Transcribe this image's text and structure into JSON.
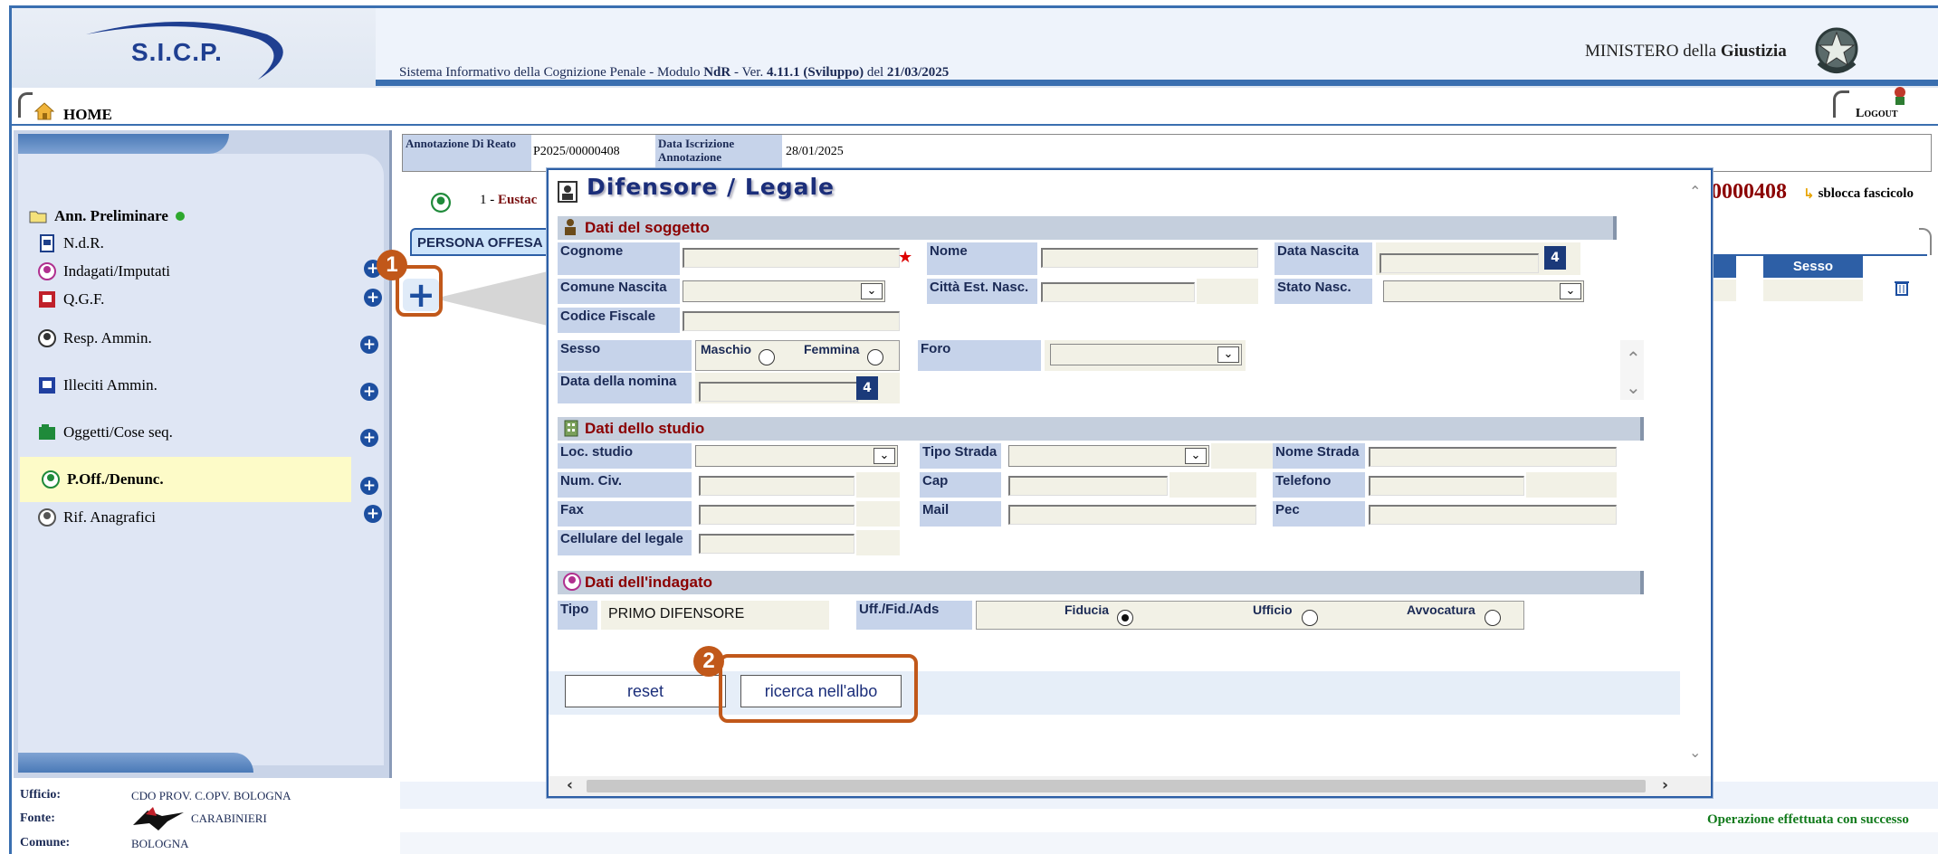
{
  "header": {
    "logo_text": "S.I.C.P.",
    "system_title_parts": [
      "S",
      "istema ",
      "I",
      "nformativo della ",
      "C",
      "ognizione ",
      "P",
      "enale - Modulo ",
      "NdR",
      " - Ver. ",
      "4.11.1 (Sviluppo)",
      " del ",
      "21/03/2025"
    ],
    "ministry_prefix": "MINISTERO della ",
    "ministry_bold": "Giustizia"
  },
  "homebar": {
    "home_label": "HOME",
    "logout_label": "Logout"
  },
  "sidebar": {
    "items": [
      {
        "label": "Ann. Preliminare",
        "icon": "folder-open-icon",
        "status": "green-dot"
      },
      {
        "label": "N.d.R.",
        "icon": "document-icon"
      },
      {
        "label": "Indagati/Imputati",
        "icon": "person-icon"
      },
      {
        "label": "Q.G.F.",
        "icon": "register-icon"
      },
      {
        "label": "Resp. Ammin.",
        "icon": "person-gray-icon"
      },
      {
        "label": "Illeciti Ammin.",
        "icon": "document-blue-icon"
      },
      {
        "label": "Oggetti/Cose seq.",
        "icon": "box-green-icon"
      },
      {
        "label": "P.Off./Denunc.",
        "icon": "person-green-icon",
        "selected": true
      },
      {
        "label": "Rif. Anagrafici",
        "icon": "person-gray-icon"
      }
    ]
  },
  "footer_info": {
    "ufficio_label": "Ufficio:",
    "ufficio_value": "CDO PROV. C.OPV. BOLOGNA",
    "fonte_label": "Fonte:",
    "fonte_value": "CARABINIERI",
    "comune_label": "Comune:",
    "comune_value": "BOLOGNA"
  },
  "status": {
    "message": "Operazione effettuata con successo"
  },
  "annotation": {
    "label1": "Annotazione Di Reato",
    "value1": "P2025/00000408",
    "label2": "Data Iscrizione Annotazione",
    "value2": "28/01/2025"
  },
  "main": {
    "row_number": "1 - ",
    "row_name": "Eustac",
    "fascicolo_number": "0000408",
    "sblocca_label": "sblocca fascicolo",
    "tab_label": "PERSONA OFFESA",
    "sesso_header": "Sesso"
  },
  "modal": {
    "title": "Difensore / Legale",
    "sections": {
      "soggetto": "Dati del soggetto",
      "studio": "Dati dello studio",
      "indagato": "Dati dell'indagato"
    },
    "fields": {
      "cognome": "Cognome",
      "nome": "Nome",
      "data_nascita": "Data Nascita",
      "comune_nascita": "Comune Nascita",
      "citta_est": "Città Est. Nasc.",
      "stato_nasc": "Stato Nasc.",
      "codice_fiscale": "Codice Fiscale",
      "sesso": "Sesso",
      "maschio": "Maschio",
      "femmina": "Femmina",
      "foro": "Foro",
      "data_nomina": "Data della nomina",
      "loc_studio": "Loc. studio",
      "tipo_strada": "Tipo Strada",
      "nome_strada": "Nome Strada",
      "num_civ": "Num. Civ.",
      "cap": "Cap",
      "telefono": "Telefono",
      "fax": "Fax",
      "mail": "Mail",
      "pec": "Pec",
      "cellulare": "Cellulare del legale",
      "tipo": "Tipo",
      "tipo_value": "PRIMO DIFENSORE",
      "uff_fid_ads": "Uff./Fid./Ads",
      "fiducia": "Fiducia",
      "ufficio": "Ufficio",
      "avvocatura": "Avvocatura",
      "selected_uff": "Fiducia"
    },
    "buttons": {
      "reset": "reset",
      "ricerca": "ricerca nell'albo"
    }
  },
  "callouts": [
    "1",
    "2"
  ],
  "colors": {
    "accent": "#3a6fb0",
    "callout": "#c1581a",
    "section_title": "#8b0000",
    "success": "#117a1b"
  }
}
